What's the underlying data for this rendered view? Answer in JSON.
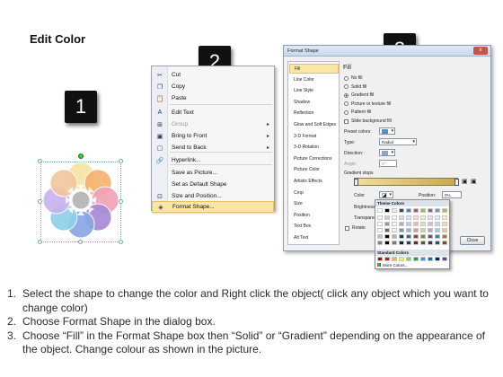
{
  "title": "Edit Color",
  "steps": [
    "1",
    "2",
    "3"
  ],
  "context_menu": {
    "items": [
      {
        "label": "Cut",
        "icon": "scissors-icon",
        "disabled": false,
        "submenu": false
      },
      {
        "label": "Copy",
        "icon": "copy-icon",
        "disabled": false,
        "submenu": false
      },
      {
        "label": "Paste",
        "icon": "paste-icon",
        "disabled": false,
        "submenu": false
      },
      {
        "label": "Edit Text",
        "icon": "edit-text-icon",
        "disabled": false,
        "submenu": false
      },
      {
        "label": "Group",
        "icon": "group-icon",
        "disabled": true,
        "submenu": true
      },
      {
        "label": "Bring to Front",
        "icon": "bring-front-icon",
        "disabled": false,
        "submenu": true
      },
      {
        "label": "Send to Back",
        "icon": "send-back-icon",
        "disabled": false,
        "submenu": true
      },
      {
        "label": "Hyperlink...",
        "icon": "hyperlink-icon",
        "disabled": false,
        "submenu": false
      },
      {
        "label": "Save as Picture...",
        "icon": "",
        "disabled": false,
        "submenu": false
      },
      {
        "label": "Set as Default Shape",
        "icon": "",
        "disabled": false,
        "submenu": false
      },
      {
        "label": "Size and Position...",
        "icon": "size-icon",
        "disabled": false,
        "submenu": false
      },
      {
        "label": "Format Shape...",
        "icon": "format-shape-icon",
        "disabled": false,
        "submenu": false,
        "highlighted": true
      }
    ]
  },
  "dialog": {
    "title": "Format Shape",
    "close_symbol": "x",
    "nav": [
      "Fill",
      "Line Color",
      "Line Style",
      "Shadow",
      "Reflection",
      "Glow and Soft Edges",
      "3-D Format",
      "3-D Rotation",
      "Picture Corrections",
      "Picture Color",
      "Artistic Effects",
      "Crop",
      "Size",
      "Position",
      "Text Box",
      "Alt Text"
    ],
    "section": "Fill",
    "fill_options": [
      "No fill",
      "Solid fill",
      "Gradient fill",
      "Picture or texture fill",
      "Pattern fill"
    ],
    "selected_fill": "Gradient fill",
    "slide_background": "Slide background fill",
    "preset_label": "Preset colors:",
    "type_label": "Type:",
    "type_value": "Radial",
    "direction_label": "Direction:",
    "angle_label": "Angle:",
    "angle_value": "0°",
    "stops_label": "Gradient stops",
    "color_label": "Color",
    "position_label": "Position:",
    "position_value": "0%",
    "brightness_label": "Brightness:",
    "transparency_label": "Transparen",
    "rotate_label": "Rotate",
    "close_button": "Close"
  },
  "palette": {
    "theme_header": "Theme Colors",
    "standard_header": "Standard Colors",
    "more": "More Colors...",
    "theme_top": [
      "#ffffff",
      "#000000",
      "#eeece1",
      "#1f497d",
      "#4f81bd",
      "#c0504d",
      "#9bbb59",
      "#8064a2",
      "#4bacc6",
      "#f79646"
    ],
    "standard": [
      "#c00000",
      "#ff0000",
      "#ffc000",
      "#ffff00",
      "#92d050",
      "#00b050",
      "#00b0f0",
      "#0070c0",
      "#002060",
      "#7030a0"
    ]
  },
  "flower_colors": {
    "center": "#b9b9b9",
    "petals": [
      "#f4e6a2",
      "#f5b26e",
      "#f1a2b6",
      "#a98ad6",
      "#8aa7e6",
      "#8fd0ea",
      "#c8b4ee",
      "#f3c7a0"
    ]
  },
  "instructions": [
    {
      "num": "1.",
      "text": "Select the shape to change the color and Right click the object( click any object which you want to change color)"
    },
    {
      "num": "2.",
      "text": "Choose Format Shape in the dialog box."
    },
    {
      "num": "3.",
      "text": "Choose “Fill” in the Format Shape box then “Solid” or “Gradient” depending on the appearance of the object. Change colour as shown in the picture."
    }
  ]
}
